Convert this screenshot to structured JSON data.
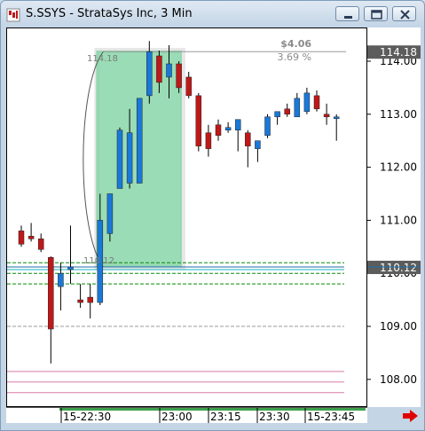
{
  "window": {
    "title": "S.SSYS - StrataSys Inc, 3 Min",
    "buttons": [
      "minimize",
      "restore",
      "close"
    ]
  },
  "chart_data": {
    "type": "candlestick",
    "symbol": "S.SSYS",
    "name": "StrataSys Inc",
    "interval": "3 Min",
    "y_ticks": [
      "114.00",
      "113.00",
      "112.00",
      "111.00",
      "110.00",
      "109.00",
      "108.00"
    ],
    "x_ticks": [
      "15-22:30",
      "23:00",
      "23:15",
      "23:30",
      "15-23:45"
    ],
    "ylim": [
      107.6,
      114.5
    ],
    "candles": [
      {
        "o": 110.8,
        "h": 110.9,
        "l": 110.5,
        "c": 110.55
      },
      {
        "o": 110.7,
        "h": 110.95,
        "l": 110.6,
        "c": 110.65
      },
      {
        "o": 110.65,
        "h": 110.75,
        "l": 110.4,
        "c": 110.45
      },
      {
        "o": 110.3,
        "h": 110.32,
        "l": 108.3,
        "c": 108.95
      },
      {
        "o": 109.75,
        "h": 110.2,
        "l": 109.3,
        "c": 110.0
      },
      {
        "o": 110.07,
        "h": 110.9,
        "l": 109.8,
        "c": 110.12
      },
      {
        "o": 109.5,
        "h": 109.8,
        "l": 109.35,
        "c": 109.45
      },
      {
        "o": 109.55,
        "h": 109.8,
        "l": 109.15,
        "c": 109.45
      },
      {
        "o": 109.45,
        "h": 111.5,
        "l": 109.4,
        "c": 111.0
      },
      {
        "o": 110.75,
        "h": 111.05,
        "l": 110.6,
        "c": 111.5
      },
      {
        "o": 111.6,
        "h": 112.75,
        "l": 111.6,
        "c": 112.7
      },
      {
        "o": 111.7,
        "h": 113.1,
        "l": 111.6,
        "c": 112.65
      },
      {
        "o": 111.7,
        "h": 113.3,
        "l": 111.7,
        "c": 113.3
      },
      {
        "o": 113.35,
        "h": 114.38,
        "l": 113.2,
        "c": 114.18
      },
      {
        "o": 114.1,
        "h": 114.2,
        "l": 113.4,
        "c": 113.6
      },
      {
        "o": 113.7,
        "h": 114.3,
        "l": 113.3,
        "c": 113.95
      },
      {
        "o": 113.95,
        "h": 114.0,
        "l": 113.4,
        "c": 113.5
      },
      {
        "o": 113.7,
        "h": 113.8,
        "l": 113.3,
        "c": 113.35
      },
      {
        "o": 113.35,
        "h": 113.4,
        "l": 112.3,
        "c": 112.4
      },
      {
        "o": 112.65,
        "h": 112.8,
        "l": 112.2,
        "c": 112.35
      },
      {
        "o": 112.8,
        "h": 112.9,
        "l": 112.5,
        "c": 112.6
      },
      {
        "o": 112.7,
        "h": 112.85,
        "l": 112.65,
        "c": 112.75
      },
      {
        "o": 112.7,
        "h": 112.9,
        "l": 112.3,
        "c": 112.9
      },
      {
        "o": 112.65,
        "h": 112.7,
        "l": 112.0,
        "c": 112.4
      },
      {
        "o": 112.35,
        "h": 112.5,
        "l": 112.1,
        "c": 112.5
      },
      {
        "o": 112.6,
        "h": 113.0,
        "l": 112.55,
        "c": 112.95
      },
      {
        "o": 112.95,
        "h": 113.05,
        "l": 112.8,
        "c": 113.05
      },
      {
        "o": 113.1,
        "h": 113.2,
        "l": 112.95,
        "c": 113.0
      },
      {
        "o": 112.95,
        "h": 113.4,
        "l": 112.95,
        "c": 113.3
      },
      {
        "o": 113.05,
        "h": 113.5,
        "l": 113.0,
        "c": 113.4
      },
      {
        "o": 113.35,
        "h": 113.45,
        "l": 113.05,
        "c": 113.1
      },
      {
        "o": 113.0,
        "h": 113.2,
        "l": 112.8,
        "c": 112.95
      },
      {
        "o": 112.95,
        "h": 113.0,
        "l": 112.5,
        "c": 112.95
      }
    ],
    "price_labels": {
      "high": "114.18",
      "current": "110.12"
    },
    "measurement": {
      "change": "$4.06",
      "percent": "3.69 %",
      "from_label": "110.12",
      "to_label": "114.18"
    },
    "levels": [
      {
        "price": 110.2,
        "color": "#0a8a0a",
        "style": "dashed"
      },
      {
        "price": 110.12,
        "color": "#1e6ea8",
        "style": "solid"
      },
      {
        "price": 110.07,
        "color": "#1ab0c0",
        "style": "solid"
      },
      {
        "price": 110.0,
        "color": "#0a8a0a",
        "style": "dashed"
      },
      {
        "price": 109.8,
        "color": "#0a8a0a",
        "style": "dashed"
      },
      {
        "price": 109.0,
        "color": "#999999",
        "style": "dashed"
      },
      {
        "price": 108.15,
        "color": "#d77aa8",
        "style": "solid"
      },
      {
        "price": 107.95,
        "color": "#d77aa8",
        "style": "solid"
      },
      {
        "price": 107.75,
        "color": "#d77aa8",
        "style": "solid"
      }
    ],
    "colors": {
      "up": "#1a78d8",
      "down": "#c01818",
      "wick": "#000000",
      "highlight": "#7fd3a2"
    }
  }
}
